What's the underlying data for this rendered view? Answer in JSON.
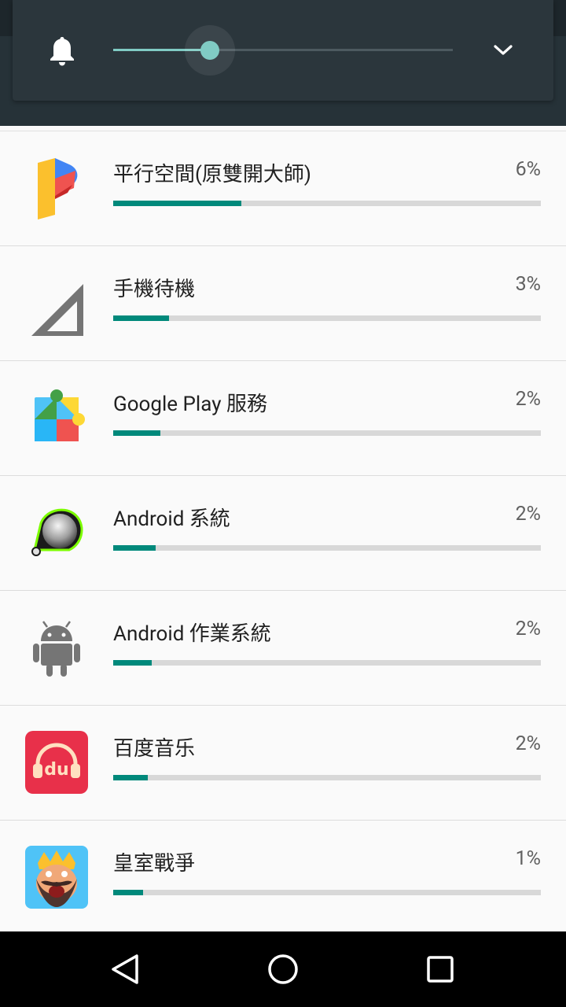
{
  "volume": {
    "level_fraction": 0.28,
    "ringer_icon": "bell-icon",
    "expand_icon": "chevron-down-icon"
  },
  "apps": [
    {
      "name": "平行空間(原雙開大師)",
      "percent": "6%",
      "value": 6,
      "bar_fraction": 0.3,
      "icon": "parallel-space-icon"
    },
    {
      "name": "手機待機",
      "percent": "3%",
      "value": 3,
      "bar_fraction": 0.13,
      "icon": "signal-icon"
    },
    {
      "name": "Google Play 服務",
      "percent": "2%",
      "value": 2,
      "bar_fraction": 0.11,
      "icon": "google-play-services-icon"
    },
    {
      "name": "Android 系統",
      "percent": "2%",
      "value": 2,
      "bar_fraction": 0.1,
      "icon": "android-system-icon"
    },
    {
      "name": "Android 作業系統",
      "percent": "2%",
      "value": 2,
      "bar_fraction": 0.09,
      "icon": "android-robot-icon"
    },
    {
      "name": "百度音乐",
      "percent": "2%",
      "value": 2,
      "bar_fraction": 0.08,
      "icon": "baidu-music-icon"
    },
    {
      "name": "皇室戰爭",
      "percent": "1%",
      "value": 1,
      "bar_fraction": 0.07,
      "icon": "clash-royale-icon"
    }
  ],
  "colors": {
    "accent": "#00897b",
    "slider": "#80cbc4",
    "panel": "#2b363c",
    "header": "#263238"
  },
  "navigation": {
    "back_icon": "back-icon",
    "home_icon": "home-icon",
    "recents_icon": "recents-icon"
  }
}
